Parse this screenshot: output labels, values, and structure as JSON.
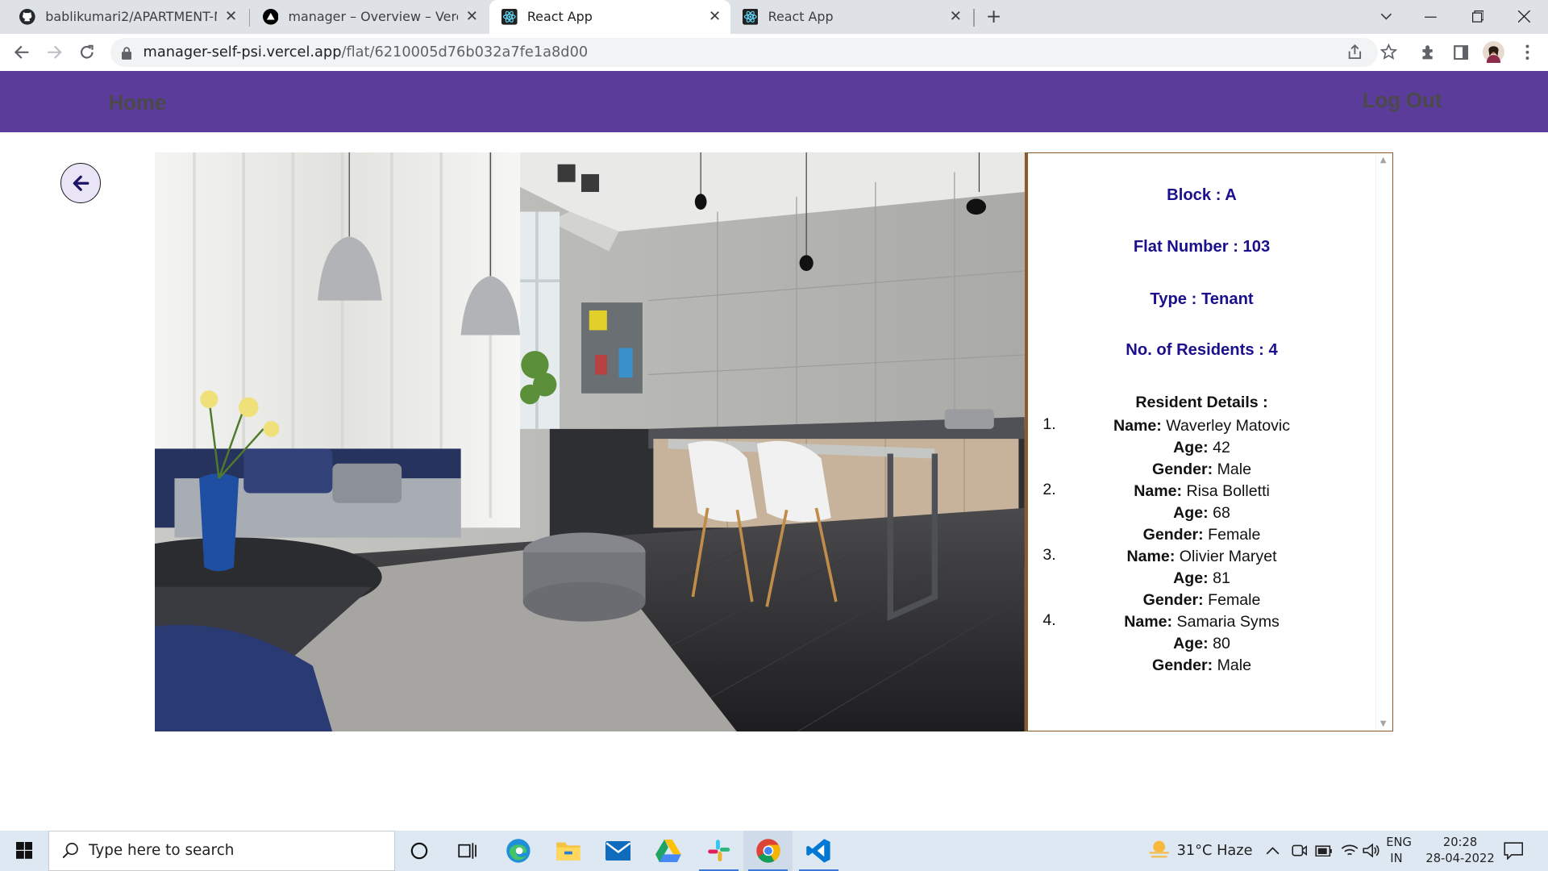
{
  "browser": {
    "tabs": [
      {
        "title": "bablikumari2/APARTMENT-MAN",
        "icon": "github-icon",
        "active": false
      },
      {
        "title": "manager – Overview – Vercel",
        "icon": "vercel-icon",
        "active": false
      },
      {
        "title": "React App",
        "icon": "react-icon",
        "active": true
      },
      {
        "title": "React App",
        "icon": "react-icon",
        "active": false
      }
    ],
    "url_host": "manager-self-psi.vercel.app",
    "url_path": "/flat/6210005d76b032a7fe1a8d00"
  },
  "app": {
    "nav_home": "Home",
    "nav_logout": "Log Out",
    "accent_color": "#5b3c9b"
  },
  "flat": {
    "block": "Block : A",
    "flat_number": "Flat Number : 103",
    "type": "Type : Tenant",
    "residents_count": "No. of Residents : 4",
    "resident_details_title": "Resident Details :",
    "residents": [
      {
        "num": "1.",
        "name_label": "Name:",
        "name": "Waverley Matovic",
        "age_label": "Age:",
        "age": "42",
        "gender_label": "Gender:",
        "gender": "Male"
      },
      {
        "num": "2.",
        "name_label": "Name:",
        "name": "Risa Bolletti",
        "age_label": "Age:",
        "age": "68",
        "gender_label": "Gender:",
        "gender": "Female"
      },
      {
        "num": "3.",
        "name_label": "Name:",
        "name": "Olivier Maryet",
        "age_label": "Age:",
        "age": "81",
        "gender_label": "Gender:",
        "gender": "Female"
      },
      {
        "num": "4.",
        "name_label": "Name:",
        "name": "Samaria Syms",
        "age_label": "Age:",
        "age": "80",
        "gender_label": "Gender:",
        "gender": "Male"
      }
    ]
  },
  "taskbar": {
    "search_placeholder": "Type here to search",
    "weather": "31°C  Haze",
    "lang_top": "ENG",
    "lang_bottom": "IN",
    "time": "20:28",
    "date": "28-04-2022"
  }
}
